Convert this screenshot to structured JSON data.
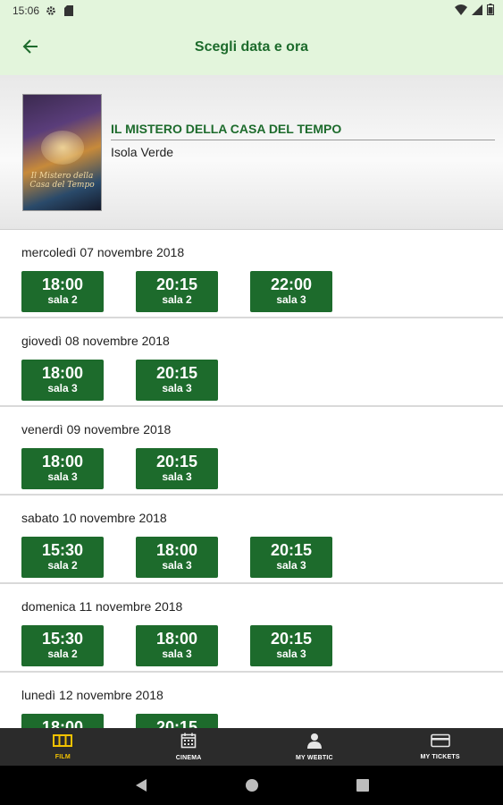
{
  "status_bar": {
    "time": "15:06",
    "left_icons": [
      "gear-icon",
      "sd-card-icon"
    ],
    "right_icons": [
      "wifi-icon",
      "signal-icon",
      "battery-icon"
    ]
  },
  "app_bar": {
    "back_icon": "arrow-left-icon",
    "title": "Scegli data e ora"
  },
  "movie": {
    "title": "IL MISTERO DELLA CASA DEL TEMPO",
    "cinema": "Isola Verde",
    "poster_text": "Il Mistero della Casa del Tempo"
  },
  "days": [
    {
      "date": "mercoledì 07 novembre 2018",
      "slots": [
        {
          "time": "18:00",
          "room": "sala 2"
        },
        {
          "time": "20:15",
          "room": "sala 2"
        },
        {
          "time": "22:00",
          "room": "sala 3"
        }
      ]
    },
    {
      "date": "giovedì 08 novembre 2018",
      "slots": [
        {
          "time": "18:00",
          "room": "sala 3"
        },
        {
          "time": "20:15",
          "room": "sala 3"
        }
      ]
    },
    {
      "date": "venerdì 09 novembre 2018",
      "slots": [
        {
          "time": "18:00",
          "room": "sala 3"
        },
        {
          "time": "20:15",
          "room": "sala 3"
        }
      ]
    },
    {
      "date": "sabato 10 novembre 2018",
      "slots": [
        {
          "time": "15:30",
          "room": "sala 2"
        },
        {
          "time": "18:00",
          "room": "sala 3"
        },
        {
          "time": "20:15",
          "room": "sala 3"
        }
      ]
    },
    {
      "date": "domenica 11 novembre 2018",
      "slots": [
        {
          "time": "15:30",
          "room": "sala 2"
        },
        {
          "time": "18:00",
          "room": "sala 3"
        },
        {
          "time": "20:15",
          "room": "sala 3"
        }
      ]
    },
    {
      "date": "lunedì 12 novembre 2018",
      "slots": [
        {
          "time": "18:00",
          "room": ""
        },
        {
          "time": "20:15",
          "room": ""
        }
      ]
    }
  ],
  "bottom_nav": [
    {
      "label": "FILM",
      "icon": "film-icon",
      "active": true
    },
    {
      "label": "CINEMA",
      "icon": "calendar-icon",
      "active": false
    },
    {
      "label": "MY WEBTIC",
      "icon": "person-icon",
      "active": false
    },
    {
      "label": "MY TICKETS",
      "icon": "ticket-icon",
      "active": false
    }
  ],
  "colors": {
    "accent": "#1d6b2c",
    "app_bar_bg": "#e3f5dc",
    "nav_bg": "#2b2b2b",
    "nav_active": "#f2c200"
  }
}
